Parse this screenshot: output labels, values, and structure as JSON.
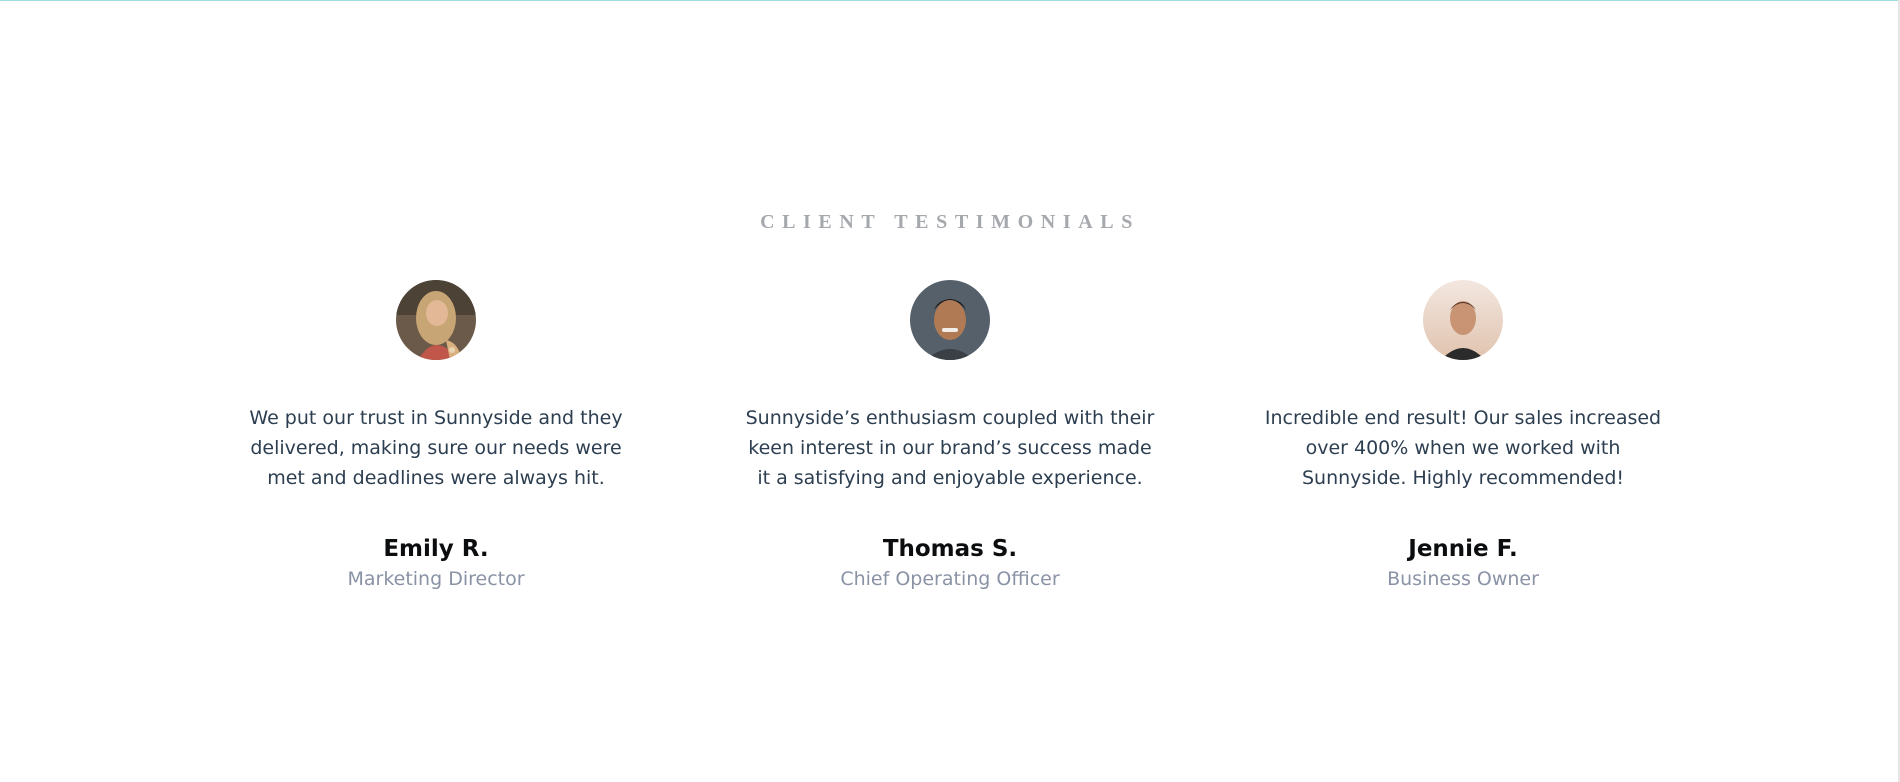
{
  "section": {
    "title": "CLIENT TESTIMONIALS"
  },
  "testimonials": [
    {
      "quote": "We put our trust in Sunnyside and they delivered, making sure our needs were met and deadlines were always hit.",
      "name": "Emily R.",
      "role": "Marketing Director",
      "avatar": "emily-photo"
    },
    {
      "quote": "Sunnyside’s enthusiasm coupled with their keen interest in our brand’s success made it a satisfying and enjoyable experience.",
      "name": "Thomas S.",
      "role": "Chief Operating Officer",
      "avatar": "thomas-photo"
    },
    {
      "quote": "Incredible end result! Our sales increased over 400% when we worked with Sunnyside. Highly recommended!",
      "name": "Jennie F.",
      "role": "Business Owner",
      "avatar": "jennie-photo"
    }
  ],
  "colors": {
    "title": "#a5a9ae",
    "quote": "#2c3e50",
    "name": "#0b0d0f",
    "role": "#8a93a5",
    "top_border": "#9fdcdc"
  }
}
